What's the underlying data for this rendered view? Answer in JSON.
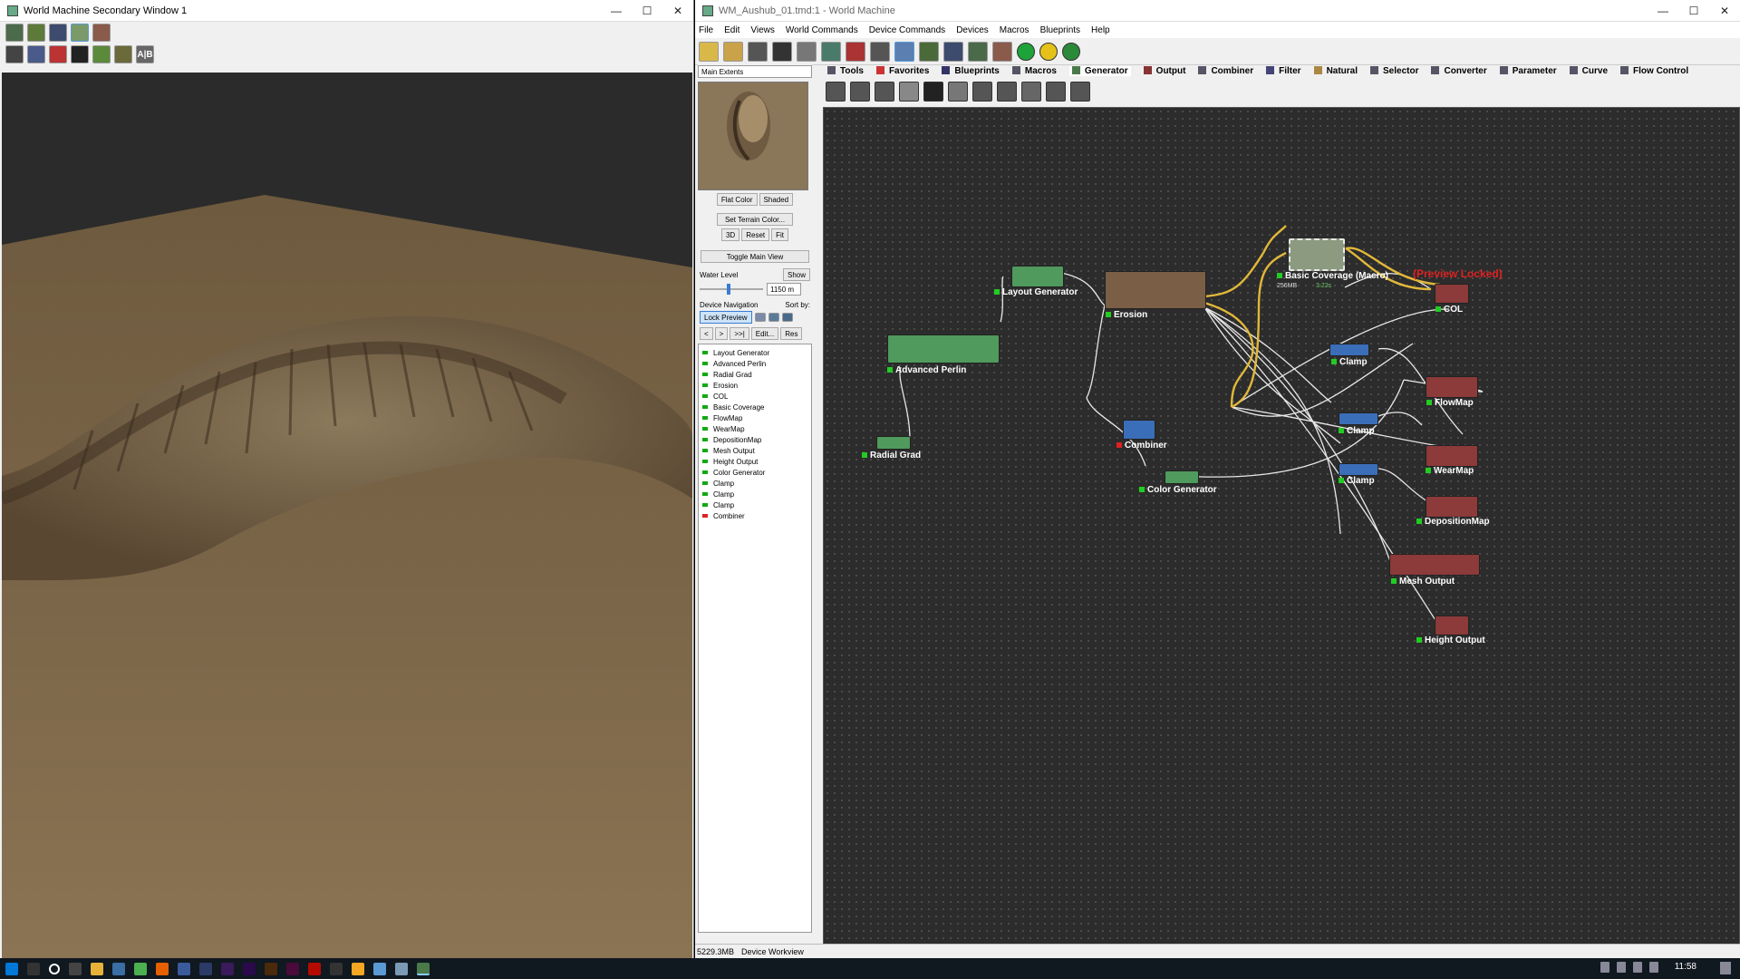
{
  "secondary_window": {
    "title": "World Machine Secondary Window 1",
    "toolbar_row1": [
      "camera-icon",
      "grid-icon",
      "globe-icon",
      "terrain-icon",
      "texture-icon"
    ],
    "toolbar_row2": [
      "render-icon",
      "heightfield-icon",
      "stop-icon",
      "settings-icon",
      "line-icon",
      "help-icon",
      "ab-icon"
    ],
    "ab_label": "A|B"
  },
  "main_window": {
    "title": "WM_Aushub_01.tmd:1 - World Machine",
    "menu": [
      "File",
      "Edit",
      "Views",
      "World Commands",
      "Device Commands",
      "Devices",
      "Macros",
      "Blueprints",
      "Help"
    ],
    "side": {
      "extents": "Main Extents",
      "flat_color": "Flat Color",
      "shaded": "Shaded",
      "set_terrain_color": "Set Terrain Color...",
      "btn_3d": "3D",
      "btn_reset": "Reset",
      "btn_fit": "Fit",
      "toggle_main_view": "Toggle Main View",
      "water_level": "Water Level",
      "show": "Show",
      "water_value": "1150 m",
      "device_navigation": "Device Navigation",
      "sort_by": "Sort by:",
      "lock_preview": "Lock Preview",
      "nav_prev": "<",
      "nav_next": ">",
      "nav_end": ">>|",
      "edit": "Edit...",
      "res": "Res",
      "devices": [
        {
          "name": "Layout Generator",
          "ok": true
        },
        {
          "name": "Advanced Perlin",
          "ok": true
        },
        {
          "name": "Radial Grad",
          "ok": true
        },
        {
          "name": "Erosion",
          "ok": true
        },
        {
          "name": "COL",
          "ok": true
        },
        {
          "name": "Basic Coverage",
          "ok": true
        },
        {
          "name": "FlowMap",
          "ok": true
        },
        {
          "name": "WearMap",
          "ok": true
        },
        {
          "name": "DepositionMap",
          "ok": true
        },
        {
          "name": "Mesh Output",
          "ok": true
        },
        {
          "name": "Height Output",
          "ok": true
        },
        {
          "name": "Color Generator",
          "ok": true
        },
        {
          "name": "Clamp",
          "ok": true
        },
        {
          "name": "Clamp",
          "ok": true
        },
        {
          "name": "Clamp",
          "ok": true
        },
        {
          "name": "Combiner",
          "ok": false
        }
      ]
    },
    "tabs": [
      "Tools",
      "Favorites",
      "Blueprints",
      "Macros",
      "Generator",
      "Output",
      "Combiner",
      "Filter",
      "Natural",
      "Selector",
      "Converter",
      "Parameter",
      "Curve",
      "Flow Control"
    ],
    "active_tab": "Generator",
    "graph": {
      "preview_locked": "(Preview Locked)",
      "macro_mem": "256MB",
      "macro_time": "3.22s",
      "nodes": {
        "layout_generator": "Layout Generator",
        "advanced_perlin": "Advanced Perlin",
        "radial_grad": "Radial Grad",
        "erosion": "Erosion",
        "combiner": "Combiner",
        "color_generator": "Color Generator",
        "basic_coverage": "Basic Coverage (Macro)",
        "col": "COL",
        "clamp1": "Clamp",
        "clamp2": "Clamp",
        "clamp3": "Clamp",
        "flowmap": "FlowMap",
        "wearmap": "WearMap",
        "depositionmap": "DepositionMap",
        "mesh_output": "Mesh Output",
        "height_output": "Height Output"
      }
    },
    "status": {
      "memory": "5229.3MB",
      "mode": "Device Workview"
    }
  },
  "taskbar": {
    "clock": "11:58"
  }
}
